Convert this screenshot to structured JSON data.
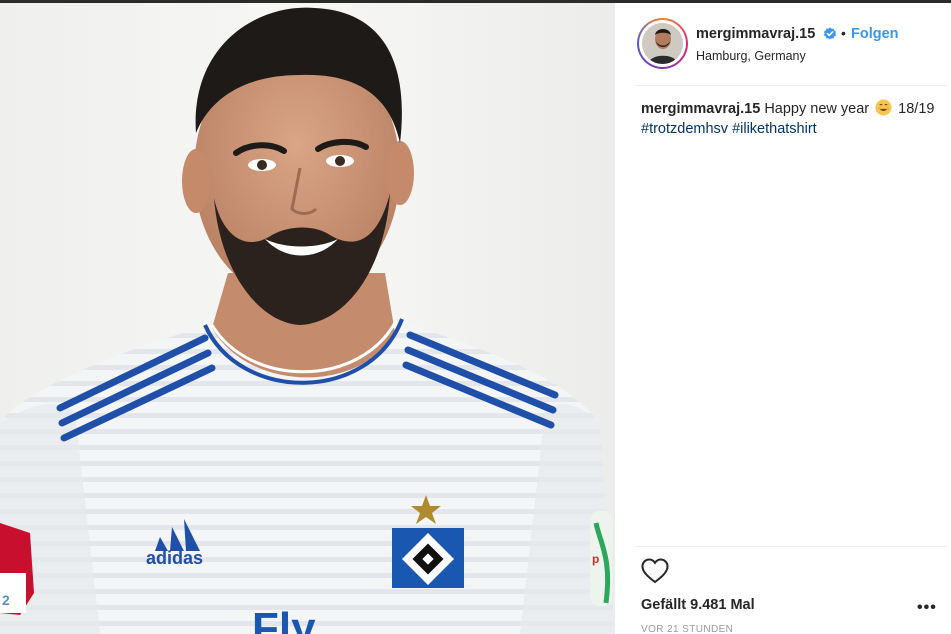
{
  "post": {
    "username": "mergimmavraj.15",
    "verified": true,
    "follow_separator": "•",
    "follow_label": "Folgen",
    "location": "Hamburg, Germany",
    "caption_user": "mergimmavraj.15",
    "caption_text": "Happy new year",
    "caption_suffix": "18/19",
    "hashtags": [
      "#trotzdemhsv",
      "#ilikethatshirt"
    ],
    "likes": "Gefällt 9.481 Mal",
    "timestamp": "VOR 21 STUNDEN",
    "more_label": "•••"
  },
  "photo": {
    "jersey_brand": "adidas",
    "jersey_sponsor": "Fly",
    "crest": "HSV diamond crest"
  },
  "colors": {
    "link_blue": "#3897f0",
    "hashtag_blue": "#003569",
    "jersey_stripe": "#1f4fa8",
    "jersey_white": "#f2f4f6"
  },
  "icons": {
    "verified": "verified-badge-icon",
    "heart": "heart-outline-icon",
    "more": "ellipsis-icon",
    "emoji": "grimacing-smile-emoji"
  }
}
